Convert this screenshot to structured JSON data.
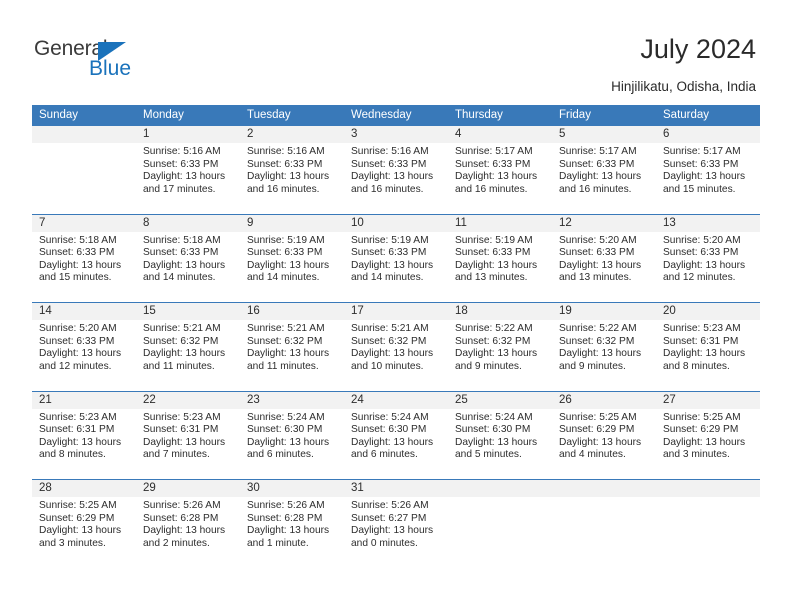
{
  "brand": {
    "name_part1": "General",
    "name_part2": "Blue",
    "accent_color": "#1a72bb"
  },
  "header": {
    "title": "July 2024",
    "subtitle": "Hinjilikatu, Odisha, India",
    "header_bg_color": "#3979b9",
    "daynum_bg_color": "#f2f2f2"
  },
  "weekday_headers": [
    "Sunday",
    "Monday",
    "Tuesday",
    "Wednesday",
    "Thursday",
    "Friday",
    "Saturday"
  ],
  "weeks": [
    [
      {
        "day": "",
        "l1": "",
        "l2": "",
        "l3": "",
        "l4": ""
      },
      {
        "day": "1",
        "l1": "Sunrise: 5:16 AM",
        "l2": "Sunset: 6:33 PM",
        "l3": "Daylight: 13 hours",
        "l4": "and 17 minutes."
      },
      {
        "day": "2",
        "l1": "Sunrise: 5:16 AM",
        "l2": "Sunset: 6:33 PM",
        "l3": "Daylight: 13 hours",
        "l4": "and 16 minutes."
      },
      {
        "day": "3",
        "l1": "Sunrise: 5:16 AM",
        "l2": "Sunset: 6:33 PM",
        "l3": "Daylight: 13 hours",
        "l4": "and 16 minutes."
      },
      {
        "day": "4",
        "l1": "Sunrise: 5:17 AM",
        "l2": "Sunset: 6:33 PM",
        "l3": "Daylight: 13 hours",
        "l4": "and 16 minutes."
      },
      {
        "day": "5",
        "l1": "Sunrise: 5:17 AM",
        "l2": "Sunset: 6:33 PM",
        "l3": "Daylight: 13 hours",
        "l4": "and 16 minutes."
      },
      {
        "day": "6",
        "l1": "Sunrise: 5:17 AM",
        "l2": "Sunset: 6:33 PM",
        "l3": "Daylight: 13 hours",
        "l4": "and 15 minutes."
      }
    ],
    [
      {
        "day": "7",
        "l1": "Sunrise: 5:18 AM",
        "l2": "Sunset: 6:33 PM",
        "l3": "Daylight: 13 hours",
        "l4": "and 15 minutes."
      },
      {
        "day": "8",
        "l1": "Sunrise: 5:18 AM",
        "l2": "Sunset: 6:33 PM",
        "l3": "Daylight: 13 hours",
        "l4": "and 14 minutes."
      },
      {
        "day": "9",
        "l1": "Sunrise: 5:19 AM",
        "l2": "Sunset: 6:33 PM",
        "l3": "Daylight: 13 hours",
        "l4": "and 14 minutes."
      },
      {
        "day": "10",
        "l1": "Sunrise: 5:19 AM",
        "l2": "Sunset: 6:33 PM",
        "l3": "Daylight: 13 hours",
        "l4": "and 14 minutes."
      },
      {
        "day": "11",
        "l1": "Sunrise: 5:19 AM",
        "l2": "Sunset: 6:33 PM",
        "l3": "Daylight: 13 hours",
        "l4": "and 13 minutes."
      },
      {
        "day": "12",
        "l1": "Sunrise: 5:20 AM",
        "l2": "Sunset: 6:33 PM",
        "l3": "Daylight: 13 hours",
        "l4": "and 13 minutes."
      },
      {
        "day": "13",
        "l1": "Sunrise: 5:20 AM",
        "l2": "Sunset: 6:33 PM",
        "l3": "Daylight: 13 hours",
        "l4": "and 12 minutes."
      }
    ],
    [
      {
        "day": "14",
        "l1": "Sunrise: 5:20 AM",
        "l2": "Sunset: 6:33 PM",
        "l3": "Daylight: 13 hours",
        "l4": "and 12 minutes."
      },
      {
        "day": "15",
        "l1": "Sunrise: 5:21 AM",
        "l2": "Sunset: 6:32 PM",
        "l3": "Daylight: 13 hours",
        "l4": "and 11 minutes."
      },
      {
        "day": "16",
        "l1": "Sunrise: 5:21 AM",
        "l2": "Sunset: 6:32 PM",
        "l3": "Daylight: 13 hours",
        "l4": "and 11 minutes."
      },
      {
        "day": "17",
        "l1": "Sunrise: 5:21 AM",
        "l2": "Sunset: 6:32 PM",
        "l3": "Daylight: 13 hours",
        "l4": "and 10 minutes."
      },
      {
        "day": "18",
        "l1": "Sunrise: 5:22 AM",
        "l2": "Sunset: 6:32 PM",
        "l3": "Daylight: 13 hours",
        "l4": "and 9 minutes."
      },
      {
        "day": "19",
        "l1": "Sunrise: 5:22 AM",
        "l2": "Sunset: 6:32 PM",
        "l3": "Daylight: 13 hours",
        "l4": "and 9 minutes."
      },
      {
        "day": "20",
        "l1": "Sunrise: 5:23 AM",
        "l2": "Sunset: 6:31 PM",
        "l3": "Daylight: 13 hours",
        "l4": "and 8 minutes."
      }
    ],
    [
      {
        "day": "21",
        "l1": "Sunrise: 5:23 AM",
        "l2": "Sunset: 6:31 PM",
        "l3": "Daylight: 13 hours",
        "l4": "and 8 minutes."
      },
      {
        "day": "22",
        "l1": "Sunrise: 5:23 AM",
        "l2": "Sunset: 6:31 PM",
        "l3": "Daylight: 13 hours",
        "l4": "and 7 minutes."
      },
      {
        "day": "23",
        "l1": "Sunrise: 5:24 AM",
        "l2": "Sunset: 6:30 PM",
        "l3": "Daylight: 13 hours",
        "l4": "and 6 minutes."
      },
      {
        "day": "24",
        "l1": "Sunrise: 5:24 AM",
        "l2": "Sunset: 6:30 PM",
        "l3": "Daylight: 13 hours",
        "l4": "and 6 minutes."
      },
      {
        "day": "25",
        "l1": "Sunrise: 5:24 AM",
        "l2": "Sunset: 6:30 PM",
        "l3": "Daylight: 13 hours",
        "l4": "and 5 minutes."
      },
      {
        "day": "26",
        "l1": "Sunrise: 5:25 AM",
        "l2": "Sunset: 6:29 PM",
        "l3": "Daylight: 13 hours",
        "l4": "and 4 minutes."
      },
      {
        "day": "27",
        "l1": "Sunrise: 5:25 AM",
        "l2": "Sunset: 6:29 PM",
        "l3": "Daylight: 13 hours",
        "l4": "and 3 minutes."
      }
    ],
    [
      {
        "day": "28",
        "l1": "Sunrise: 5:25 AM",
        "l2": "Sunset: 6:29 PM",
        "l3": "Daylight: 13 hours",
        "l4": "and 3 minutes."
      },
      {
        "day": "29",
        "l1": "Sunrise: 5:26 AM",
        "l2": "Sunset: 6:28 PM",
        "l3": "Daylight: 13 hours",
        "l4": "and 2 minutes."
      },
      {
        "day": "30",
        "l1": "Sunrise: 5:26 AM",
        "l2": "Sunset: 6:28 PM",
        "l3": "Daylight: 13 hours",
        "l4": "and 1 minute."
      },
      {
        "day": "31",
        "l1": "Sunrise: 5:26 AM",
        "l2": "Sunset: 6:27 PM",
        "l3": "Daylight: 13 hours",
        "l4": "and 0 minutes."
      },
      {
        "day": "",
        "l1": "",
        "l2": "",
        "l3": "",
        "l4": ""
      },
      {
        "day": "",
        "l1": "",
        "l2": "",
        "l3": "",
        "l4": ""
      },
      {
        "day": "",
        "l1": "",
        "l2": "",
        "l3": "",
        "l4": ""
      }
    ]
  ]
}
